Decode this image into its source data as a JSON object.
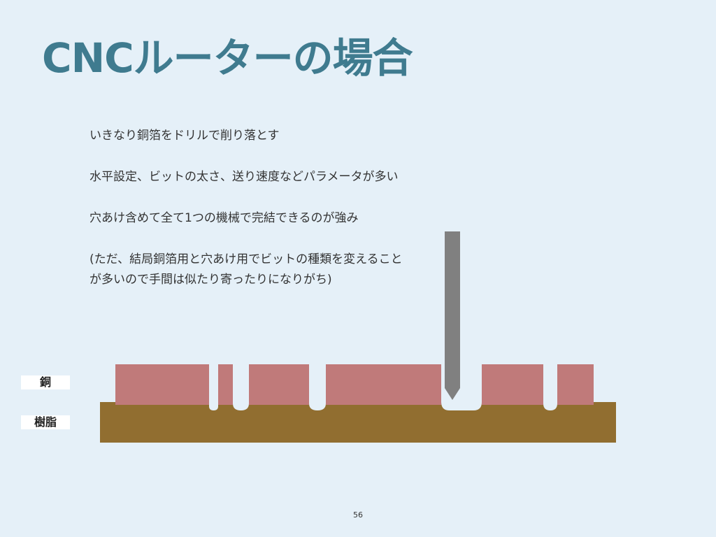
{
  "slide": {
    "title": "CNCルーターの場合",
    "page_number": "56"
  },
  "bullets": [
    "いきなり銅箔をドリルで削り落とす",
    "水平設定、ビットの太さ、送り速度などパラメータが多い",
    "穴あけ含めて全て1つの機械で完結できるのが強み"
  ],
  "note": {
    "line1": "(ただ、結局銅箔用と穴あけ用でビットの種類を変えること",
    "line2": "が多いので手間は似たり寄ったりになりがち)"
  },
  "diagram": {
    "labels": {
      "copper": "銅",
      "resin": "樹脂"
    },
    "colors": {
      "background": "#e5f0f8",
      "title": "#3f7b8f",
      "copper": "#c07a7a",
      "resin": "#916e30",
      "bit": "#808080",
      "label_box": "#ffffff"
    }
  }
}
